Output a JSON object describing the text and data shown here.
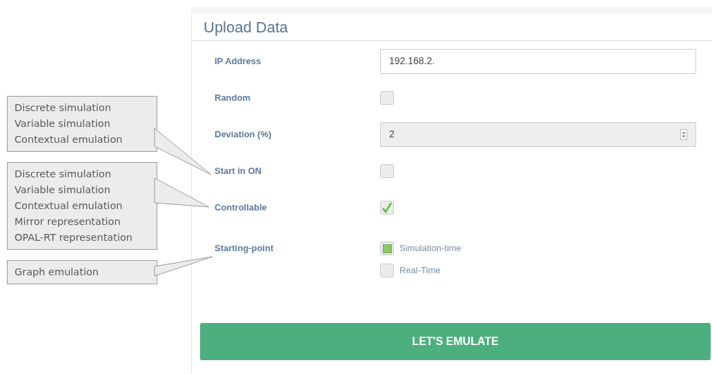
{
  "callouts": [
    {
      "lines": [
        "Discrete simulation",
        "Variable simulation",
        "Contextual emulation"
      ]
    },
    {
      "lines": [
        "Discrete simulation",
        "Variable simulation",
        "Contextual emulation",
        "Mirror representation",
        "OPAL-RT representation"
      ]
    },
    {
      "lines": [
        "Graph emulation"
      ]
    }
  ],
  "form": {
    "title": "Upload Data",
    "fields": [
      {
        "kind": "text",
        "label": "IP Address",
        "value": "192.168.2."
      },
      {
        "kind": "checkbox",
        "label": "Random",
        "checked": false
      },
      {
        "kind": "number",
        "label": "Deviation (%)",
        "value": "2",
        "disabled": true
      },
      {
        "kind": "checkbox",
        "label": "Start in ON",
        "checked": false
      },
      {
        "kind": "checkbox",
        "label": "Controllable",
        "checked": true
      },
      {
        "kind": "radio",
        "label": "Starting-point",
        "options": [
          {
            "label": "Simulation-time",
            "selected": true
          },
          {
            "label": "Real-Time",
            "selected": false
          }
        ]
      }
    ],
    "submit": "LET'S EMULATE"
  }
}
